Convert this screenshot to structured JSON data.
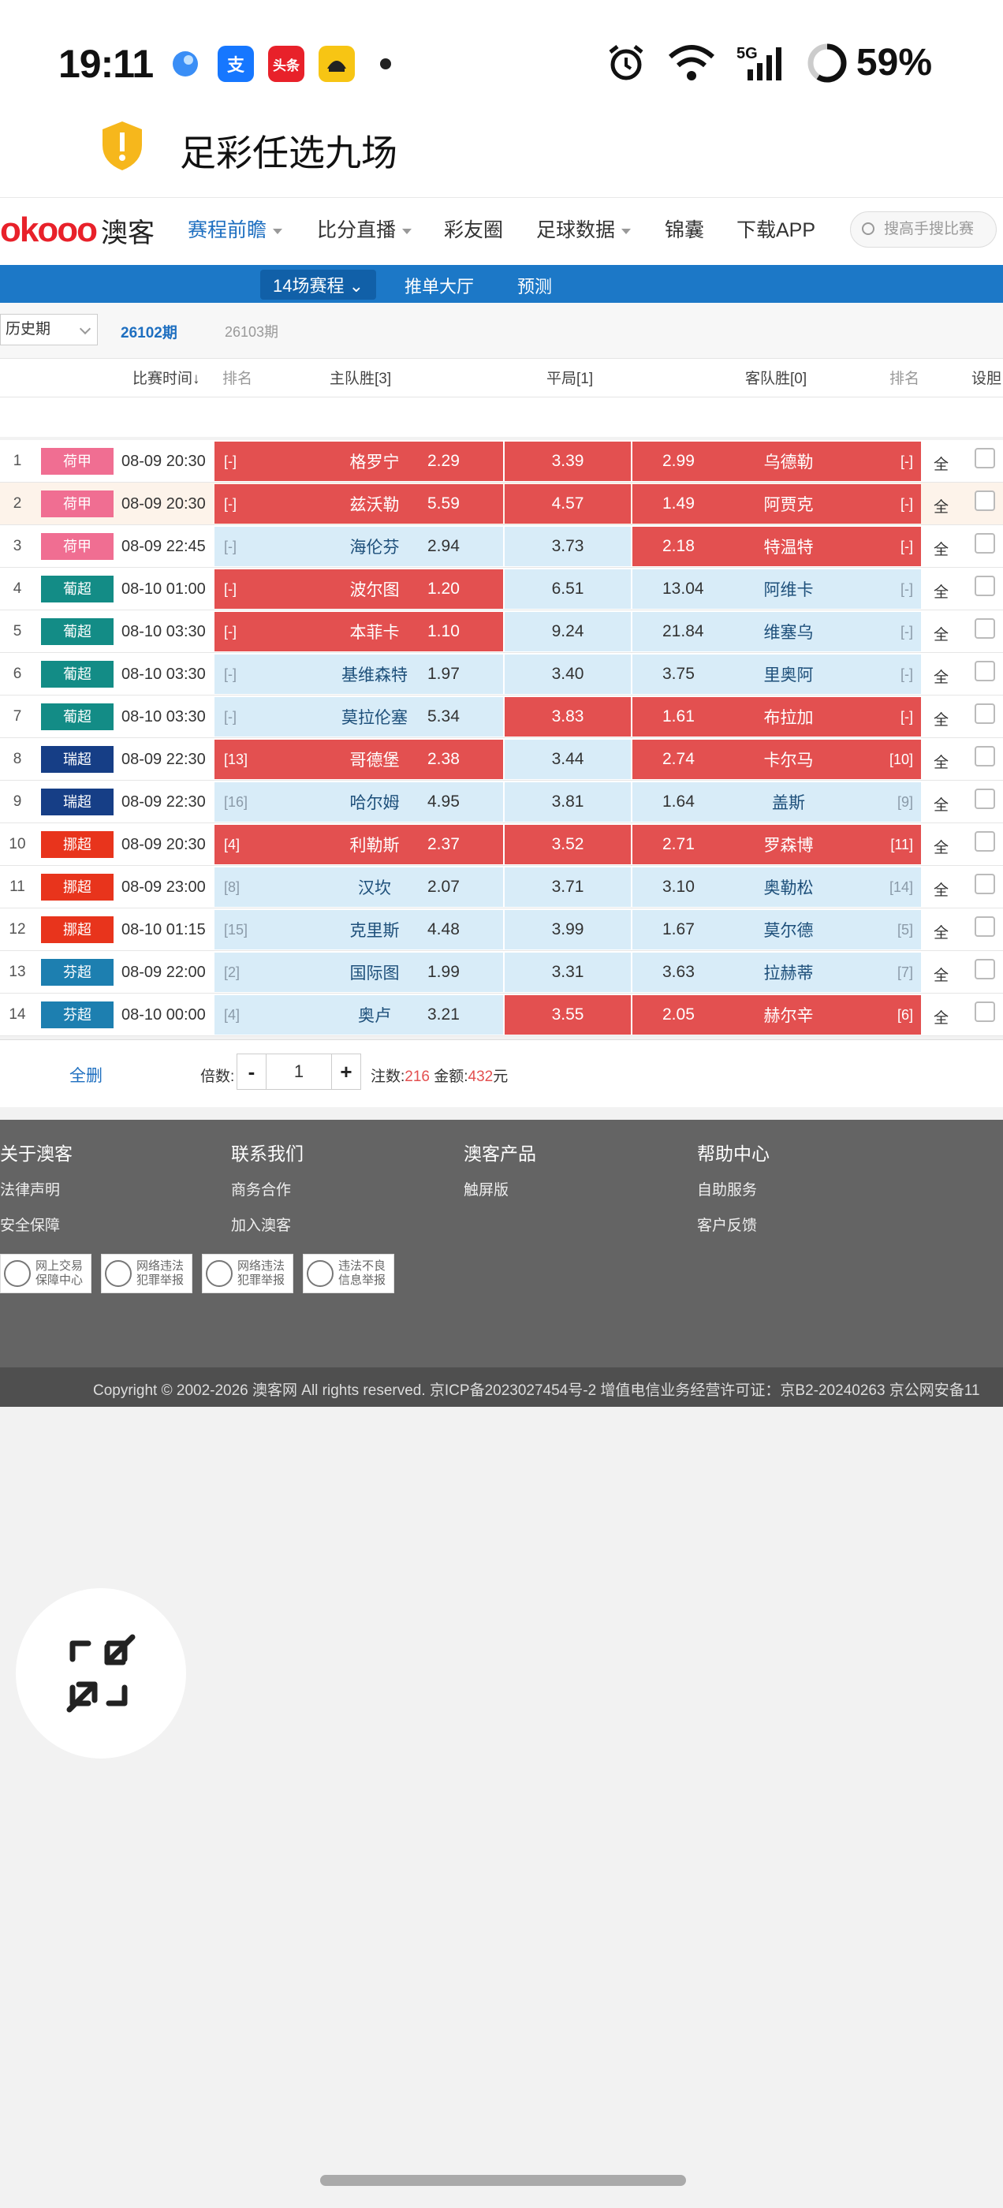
{
  "status": {
    "time": "19:11",
    "battery": "59%",
    "network": "5G",
    "app_icons": [
      "circle-app-icon",
      "alipay-icon",
      "toutiao-icon",
      "car-app-icon"
    ],
    "toutiao_label": "头条",
    "alipay_label": "支"
  },
  "page": {
    "title": "足彩任选九场"
  },
  "nav": {
    "logo_text": "okooo",
    "logo_cn": "澳客",
    "items": [
      "赛程前瞻",
      "比分直播",
      "彩友圈",
      "足球数据",
      "锦囊",
      "下载APP"
    ],
    "search_placeholder": "搜高手搜比赛"
  },
  "subtabs": [
    "14场赛程",
    "推单大厅",
    "预测"
  ],
  "period": {
    "select": "历史期",
    "current": "26102期",
    "next": "26103期"
  },
  "headers": {
    "time": "比赛时间",
    "rank": "排名",
    "home": "主队胜[3]",
    "draw": "平局[1]",
    "away": "客队胜[0]",
    "rank2": "排名",
    "gall": "设胆"
  },
  "colors": {
    "eredivisie": "#f06e92",
    "portugal": "#138c86",
    "sweden": "#163e86",
    "norway": "#e8341c",
    "finland": "#1d7fb0",
    "red_cell": "#e35050",
    "blue_cell": "#d8ecf8",
    "nav_blue": "#1c78c7"
  },
  "matches": [
    {
      "no": "1",
      "league": "荷甲",
      "lc": "eredivisie",
      "time": "08-09 20:30",
      "hr": "[-]",
      "home": "格罗宁",
      "h": "2.29",
      "d": "3.39",
      "a": "2.99",
      "away": "乌德勒",
      "ar": "[-]",
      "hs": "red",
      "ds": "red",
      "as": "red",
      "all": "全"
    },
    {
      "no": "2",
      "league": "荷甲",
      "lc": "eredivisie",
      "time": "08-09 20:30",
      "hr": "[-]",
      "home": "兹沃勒",
      "h": "5.59",
      "d": "4.57",
      "a": "1.49",
      "away": "阿贾克",
      "ar": "[-]",
      "hs": "red",
      "ds": "red",
      "as": "red",
      "all": "全"
    },
    {
      "no": "3",
      "league": "荷甲",
      "lc": "eredivisie",
      "time": "08-09 22:45",
      "hr": "[-]",
      "home": "海伦芬",
      "h": "2.94",
      "d": "3.73",
      "a": "2.18",
      "away": "特温特",
      "ar": "[-]",
      "hs": "blue",
      "ds": "blue",
      "as": "red",
      "all": "全"
    },
    {
      "no": "4",
      "league": "葡超",
      "lc": "portugal",
      "time": "08-10 01:00",
      "hr": "[-]",
      "home": "波尔图",
      "h": "1.20",
      "d": "6.51",
      "a": "13.04",
      "away": "阿维卡",
      "ar": "[-]",
      "hs": "red",
      "ds": "blue",
      "as": "blue",
      "all": "全"
    },
    {
      "no": "5",
      "league": "葡超",
      "lc": "portugal",
      "time": "08-10 03:30",
      "hr": "[-]",
      "home": "本菲卡",
      "h": "1.10",
      "d": "9.24",
      "a": "21.84",
      "away": "维塞乌",
      "ar": "[-]",
      "hs": "red",
      "ds": "blue",
      "as": "blue",
      "all": "全"
    },
    {
      "no": "6",
      "league": "葡超",
      "lc": "portugal",
      "time": "08-10 03:30",
      "hr": "[-]",
      "home": "基维森特",
      "h": "1.97",
      "d": "3.40",
      "a": "3.75",
      "away": "里奥阿",
      "ar": "[-]",
      "hs": "blue",
      "ds": "blue",
      "as": "blue",
      "all": "全"
    },
    {
      "no": "7",
      "league": "葡超",
      "lc": "portugal",
      "time": "08-10 03:30",
      "hr": "[-]",
      "home": "莫拉伦塞",
      "h": "5.34",
      "d": "3.83",
      "a": "1.61",
      "away": "布拉加",
      "ar": "[-]",
      "hs": "blue",
      "ds": "red",
      "as": "red",
      "all": "全"
    },
    {
      "no": "8",
      "league": "瑞超",
      "lc": "sweden",
      "time": "08-09 22:30",
      "hr": "[13]",
      "home": "哥德堡",
      "h": "2.38",
      "d": "3.44",
      "a": "2.74",
      "away": "卡尔马",
      "ar": "[10]",
      "hs": "red",
      "ds": "blue",
      "as": "red",
      "all": "全"
    },
    {
      "no": "9",
      "league": "瑞超",
      "lc": "sweden",
      "time": "08-09 22:30",
      "hr": "[16]",
      "home": "哈尔姆",
      "h": "4.95",
      "d": "3.81",
      "a": "1.64",
      "away": "盖斯",
      "ar": "[9]",
      "hs": "blue",
      "ds": "blue",
      "as": "blue",
      "all": "全"
    },
    {
      "no": "10",
      "league": "挪超",
      "lc": "norway",
      "time": "08-09 20:30",
      "hr": "[4]",
      "home": "利勒斯",
      "h": "2.37",
      "d": "3.52",
      "a": "2.71",
      "away": "罗森博",
      "ar": "[11]",
      "hs": "red",
      "ds": "red",
      "as": "red",
      "all": "全"
    },
    {
      "no": "11",
      "league": "挪超",
      "lc": "norway",
      "time": "08-09 23:00",
      "hr": "[8]",
      "home": "汉坎",
      "h": "2.07",
      "d": "3.71",
      "a": "3.10",
      "away": "奥勒松",
      "ar": "[14]",
      "hs": "blue",
      "ds": "blue",
      "as": "blue",
      "all": "全"
    },
    {
      "no": "12",
      "league": "挪超",
      "lc": "norway",
      "time": "08-10 01:15",
      "hr": "[15]",
      "home": "克里斯",
      "h": "4.48",
      "d": "3.99",
      "a": "1.67",
      "away": "莫尔德",
      "ar": "[5]",
      "hs": "blue",
      "ds": "blue",
      "as": "blue",
      "all": "全"
    },
    {
      "no": "13",
      "league": "芬超",
      "lc": "finland",
      "time": "08-09 22:00",
      "hr": "[2]",
      "home": "国际图",
      "h": "1.99",
      "d": "3.31",
      "a": "3.63",
      "away": "拉赫蒂",
      "ar": "[7]",
      "hs": "blue",
      "ds": "blue",
      "as": "blue",
      "all": "全"
    },
    {
      "no": "14",
      "league": "芬超",
      "lc": "finland",
      "time": "08-10 00:00",
      "hr": "[4]",
      "home": "奥卢",
      "h": "3.21",
      "d": "3.55",
      "a": "2.05",
      "away": "赫尔辛",
      "ar": "[6]",
      "hs": "blue",
      "ds": "red",
      "as": "red",
      "all": "全"
    }
  ],
  "bet": {
    "delete_all": "全删",
    "multiplier_label": "倍数:",
    "minus": "-",
    "plus": "+",
    "multiplier": "1",
    "count_label": "注数:",
    "count": "216",
    "amount_label": "金额:",
    "amount": "432",
    "unit": "元"
  },
  "footer": {
    "cols": [
      {
        "title": "关于澳客",
        "links": [
          "法律声明",
          "安全保障"
        ]
      },
      {
        "title": "联系我们",
        "links": [
          "商务合作",
          "加入澳客"
        ]
      },
      {
        "title": "澳客产品",
        "links": [
          "触屏版"
        ]
      },
      {
        "title": "帮助中心",
        "links": [
          "自助服务",
          "客户反馈"
        ]
      }
    ],
    "badges": [
      [
        "网上交易",
        "保障中心"
      ],
      [
        "网络违法",
        "犯罪举报"
      ],
      [
        "网络违法",
        "犯罪举报"
      ],
      [
        "违法不良",
        "信息举报"
      ]
    ],
    "copyright": "Copyright © 2002-2026 澳客网  All rights reserved.   京ICP备2023027454号-2  增值电信业务经营许可证：京B2-20240263  京公网安备11"
  }
}
